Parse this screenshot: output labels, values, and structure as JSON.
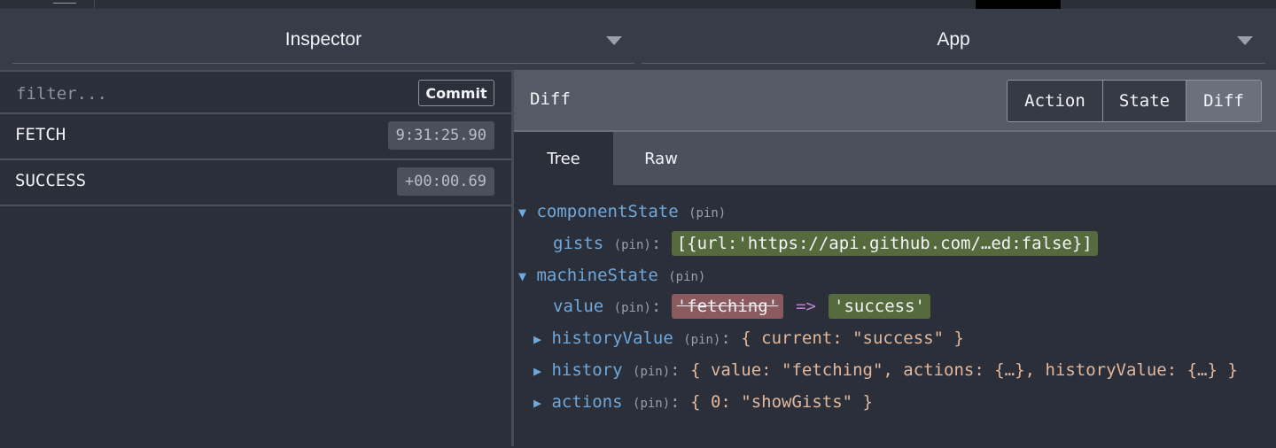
{
  "selectors": {
    "left": "Inspector",
    "right": "App"
  },
  "filter": {
    "placeholder": "filter...",
    "commit": "Commit"
  },
  "actions": [
    {
      "name": "FETCH",
      "time": "9:31:25.90"
    },
    {
      "name": "SUCCESS",
      "time": "+00:00.69"
    }
  ],
  "diff": {
    "title": "Diff",
    "tabs": [
      "Action",
      "State",
      "Diff"
    ],
    "active_tab": "Diff",
    "subtabs": [
      "Tree",
      "Raw"
    ],
    "active_subtab": "Tree"
  },
  "tree": {
    "componentState": "componentState",
    "gists_key": "gists",
    "gists_value": "[{url:'https://api.github.com/…ed:false}]",
    "machineState": "machineState",
    "value_key": "value",
    "value_old": "'fetching'",
    "value_arrow": "=>",
    "value_new": "'success'",
    "historyValue_key": "historyValue",
    "historyValue_val": "{ current: \"success\" }",
    "history_key": "history",
    "history_val": "{ value: \"fetching\", actions: {…}, historyValue: {…} }",
    "actions_key": "actions",
    "actions_val": "{ 0: \"showGists\" }",
    "pin": "(pin)",
    "colon": ":",
    "expanded_arrow": "▼",
    "collapsed_arrow": "▶"
  },
  "colors": {
    "key": "#6fa8dc",
    "added": "#556b3e",
    "removed": "#8a5a5e",
    "value": "#e2b79b"
  }
}
